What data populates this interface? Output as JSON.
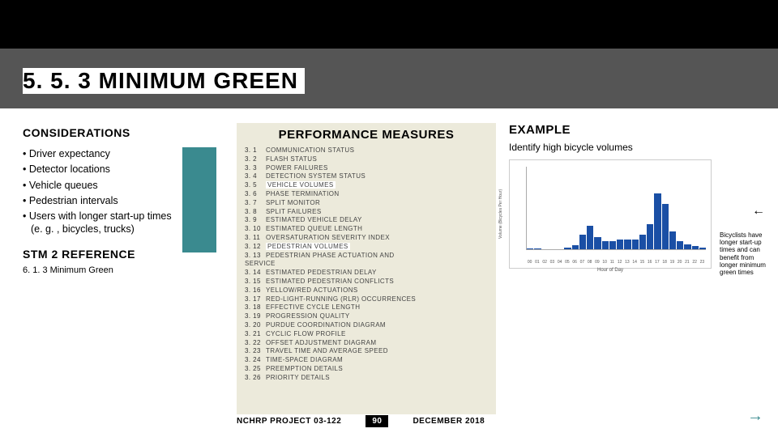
{
  "title": "5. 5. 3 MINIMUM GREEN",
  "considerations": {
    "heading": "CONSIDERATIONS",
    "items": [
      "Driver expectancy",
      "Detector locations",
      "Vehicle queues",
      "Pedestrian intervals",
      "Users with longer start-up times (e. g. , bicycles, trucks)"
    ],
    "stm2_heading": "STM 2 REFERENCE",
    "stm2_ref": "6. 1. 3 Minimum Green"
  },
  "performance": {
    "heading": "PERFORMANCE MEASURES",
    "items": [
      {
        "n": "3. 1",
        "t": "COMMUNICATION STATUS",
        "hl": false
      },
      {
        "n": "3. 2",
        "t": "FLASH STATUS",
        "hl": false
      },
      {
        "n": "3. 3",
        "t": "POWER FAILURES",
        "hl": false
      },
      {
        "n": "3. 4",
        "t": "DETECTION SYSTEM STATUS",
        "hl": false
      },
      {
        "n": "3. 5",
        "t": "VEHICLE VOLUMES",
        "hl": true
      },
      {
        "n": "3. 6",
        "t": "PHASE TERMINATION",
        "hl": false
      },
      {
        "n": "3. 7",
        "t": "SPLIT MONITOR",
        "hl": false
      },
      {
        "n": "3. 8",
        "t": "SPLIT FAILURES",
        "hl": false
      },
      {
        "n": "3. 9",
        "t": "ESTIMATED VEHICLE DELAY",
        "hl": false
      },
      {
        "n": "3. 10",
        "t": "ESTIMATED QUEUE LENGTH",
        "hl": false
      },
      {
        "n": "3. 11",
        "t": "OVERSATURATION SEVERITY INDEX",
        "hl": false
      },
      {
        "n": "3. 12",
        "t": "PEDESTRIAN VOLUMES",
        "hl": true
      },
      {
        "n": "3. 13",
        "t": "PEDESTRIAN PHASE ACTUATION AND",
        "hl": false
      }
    ],
    "service_label": "SERVICE",
    "items2": [
      {
        "n": "3. 14",
        "t": "ESTIMATED PEDESTRIAN DELAY",
        "hl": false
      },
      {
        "n": "3. 15",
        "t": "ESTIMATED PEDESTRIAN CONFLICTS",
        "hl": false
      },
      {
        "n": "3. 16",
        "t": "YELLOW/RED ACTUATIONS",
        "hl": false
      },
      {
        "n": "3. 17",
        "t": "RED-LIGHT-RUNNING (RLR) OCCURRENCES",
        "hl": false
      },
      {
        "n": "3. 18",
        "t": "EFFECTIVE CYCLE LENGTH",
        "hl": false
      },
      {
        "n": "3. 19",
        "t": "PROGRESSION QUALITY",
        "hl": false
      },
      {
        "n": "3. 20",
        "t": "PURDUE COORDINATION DIAGRAM",
        "hl": false
      },
      {
        "n": "3. 21",
        "t": "CYCLIC FLOW PROFILE",
        "hl": false
      },
      {
        "n": "3. 22",
        "t": "OFFSET ADJUSTMENT DIAGRAM",
        "hl": false
      },
      {
        "n": "3. 23",
        "t": "TRAVEL TIME AND AVERAGE SPEED",
        "hl": false
      },
      {
        "n": "3. 24",
        "t": "TIME-SPACE DIAGRAM",
        "hl": false
      },
      {
        "n": "3. 25",
        "t": "PREEMPTION DETAILS",
        "hl": false
      },
      {
        "n": "3. 26",
        "t": "PRIORITY DETAILS",
        "hl": false
      }
    ]
  },
  "example": {
    "heading": "EXAMPLE",
    "subtitle": "Identify high bicycle volumes",
    "note": "Bicyclists have longer start-up times and can benefit from longer minimum green times"
  },
  "chart_data": {
    "type": "bar",
    "title": "",
    "xlabel": "Hour of Day",
    "ylabel": "Volume (Bicycles Per Hour)",
    "ylim": [
      0,
      100
    ],
    "categories": [
      "00",
      "01",
      "02",
      "03",
      "04",
      "05",
      "06",
      "07",
      "08",
      "09",
      "10",
      "11",
      "12",
      "13",
      "14",
      "15",
      "16",
      "17",
      "18",
      "19",
      "20",
      "21",
      "22",
      "23"
    ],
    "values": [
      1,
      1,
      0,
      0,
      0,
      2,
      5,
      18,
      28,
      15,
      10,
      10,
      12,
      12,
      12,
      18,
      30,
      68,
      55,
      22,
      10,
      6,
      4,
      2
    ]
  },
  "footer": {
    "project": "NCHRP PROJECT 03-122",
    "page": "90",
    "date": "DECEMBER 2018"
  },
  "icons": {
    "next": "→",
    "arrow_left": "←"
  }
}
